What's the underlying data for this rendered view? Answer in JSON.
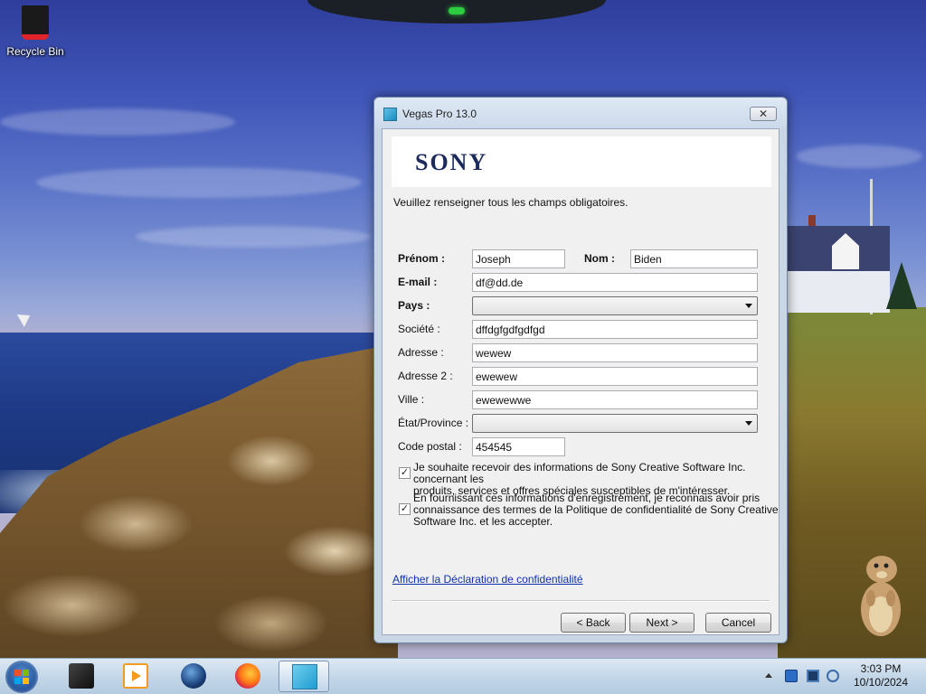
{
  "desktop": {
    "icons": [
      {
        "label": "Recycle Bin",
        "icon": "recycle-bin-icon"
      }
    ]
  },
  "window": {
    "title": "Vegas Pro 13.0",
    "close_glyph": "✕",
    "brand_logo": "SONY",
    "intro": "Veuillez renseigner tous les champs obligatoires.",
    "form": {
      "prenom": {
        "label": "Prénom :",
        "value": "Joseph"
      },
      "nom": {
        "label": "Nom :",
        "value": "Biden"
      },
      "email": {
        "label": "E-mail :",
        "value": "df@dd.de"
      },
      "pays": {
        "label": "Pays :",
        "value": ""
      },
      "societe": {
        "label": "Société :",
        "value": "dffdgfgdfgdfgd"
      },
      "adresse": {
        "label": "Adresse :",
        "value": "wewew"
      },
      "adresse2": {
        "label": "Adresse 2 :",
        "value": "ewewew"
      },
      "ville": {
        "label": "Ville :",
        "value": "ewewewwe"
      },
      "etat": {
        "label": "État/Province :",
        "value": ""
      },
      "code_postal": {
        "label": "Code postal :",
        "value": "454545"
      }
    },
    "checkboxes": [
      {
        "checked": true,
        "line1": "Je souhaite recevoir des informations de Sony Creative Software Inc. concernant les",
        "line2": "produits, services et offres spéciales susceptibles de m'intéresser."
      },
      {
        "checked": true,
        "line1": "En fournissant ces informations d'enregistrement, je reconnais avoir pris",
        "line2": "connaissance des termes de la Politique de confidentialité de Sony Creative",
        "line3": "Software Inc. et les accepter."
      }
    ],
    "check_glyph": "✓",
    "privacy_link": "Afficher la Déclaration de confidentialité",
    "buttons": {
      "back": "< Back",
      "next": "Next >",
      "cancel": "Cancel"
    }
  },
  "taskbar": {
    "pinned": [
      {
        "name": "box-app-icon"
      },
      {
        "name": "media-player-icon"
      },
      {
        "name": "globe-app-icon"
      },
      {
        "name": "firefox-icon"
      },
      {
        "name": "vegas-pro-icon",
        "active": true
      }
    ],
    "clock": {
      "time": "3:03 PM",
      "date": "10/10/2024"
    }
  },
  "colors": {
    "link": "#1030b0",
    "sony_blue": "#1c2a5c",
    "accent_red": "#e0242a"
  }
}
